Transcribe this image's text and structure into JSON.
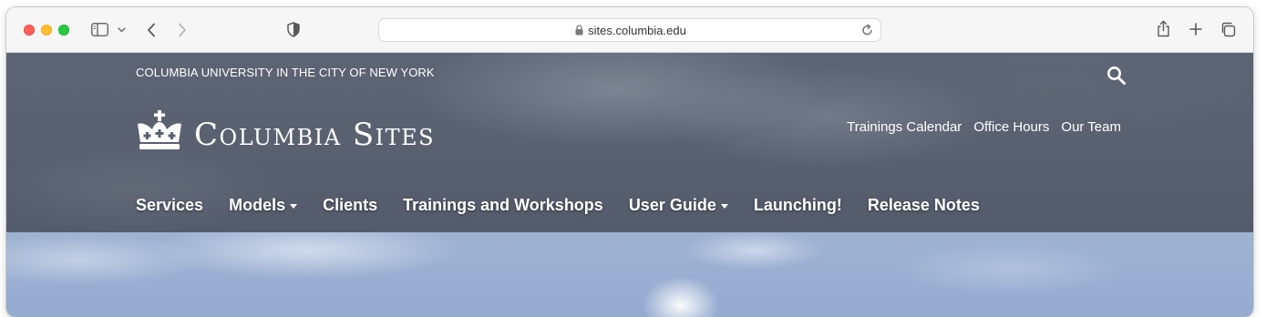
{
  "browser": {
    "url": "sites.columbia.edu",
    "icons": [
      "sidebar-icon",
      "chevron-down-icon",
      "back-icon",
      "forward-icon",
      "privacy-shield-icon",
      "lock-icon",
      "reload-icon",
      "share-icon",
      "new-tab-icon",
      "tabs-overview-icon"
    ]
  },
  "site": {
    "university_name": "COLUMBIA UNIVERSITY IN THE CITY OF NEW YORK",
    "logo_text": "Columbia Sites",
    "utility_nav": [
      {
        "label": "Trainings Calendar"
      },
      {
        "label": "Office Hours"
      },
      {
        "label": "Our Team"
      }
    ],
    "main_nav": [
      {
        "label": "Services",
        "dropdown": false
      },
      {
        "label": "Models",
        "dropdown": true
      },
      {
        "label": "Clients",
        "dropdown": false
      },
      {
        "label": "Trainings and Workshops",
        "dropdown": false
      },
      {
        "label": "User Guide",
        "dropdown": true
      },
      {
        "label": "Launching!",
        "dropdown": false
      },
      {
        "label": "Release Notes",
        "dropdown": false
      }
    ]
  },
  "colors": {
    "header_bg": "#596171",
    "hero_sky": "#9fb2d2",
    "traffic_red": "#fe5f57",
    "traffic_yellow": "#febc2e",
    "traffic_green": "#28c840"
  }
}
